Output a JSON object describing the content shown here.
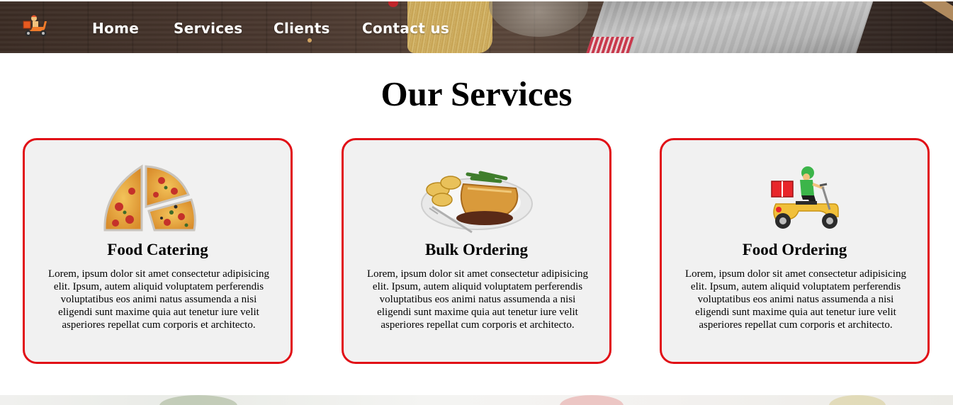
{
  "nav": {
    "links": [
      {
        "label": "Home"
      },
      {
        "label": "Services"
      },
      {
        "label": "Clients"
      },
      {
        "label": "Contact us"
      }
    ]
  },
  "services": {
    "title": "Our Services",
    "cards": [
      {
        "title": "Food Catering",
        "text": "Lorem, ipsum dolor sit amet consectetur adipisicing elit. Ipsum, autem aliquid voluptatem perferendis voluptatibus eos animi natus assumenda a nisi eligendi sunt maxime quia aut tenetur iure velit asperiores repellat cum corporis et architecto.",
        "image_icon": "pizza-slices-icon"
      },
      {
        "title": "Bulk Ordering",
        "text": "Lorem, ipsum dolor sit amet consectetur adipisicing elit. Ipsum, autem aliquid voluptatem perferendis voluptatibus eos animi natus assumenda a nisi eligendi sunt maxime quia aut tenetur iure velit asperiores repellat cum corporis et architecto.",
        "image_icon": "food-plate-icon"
      },
      {
        "title": "Food Ordering",
        "text": "Lorem, ipsum dolor sit amet consectetur adipisicing elit. Ipsum, autem aliquid voluptatem perferendis voluptatibus eos animi natus assumenda a nisi eligendi sunt maxime quia aut tenetur iure velit asperiores repellat cum corporis et architecto.",
        "image_icon": "delivery-scooter-icon"
      }
    ]
  },
  "colors": {
    "card_border": "#e10f16",
    "card_background": "#f1f1f1",
    "nav_text": "#ffffff"
  }
}
